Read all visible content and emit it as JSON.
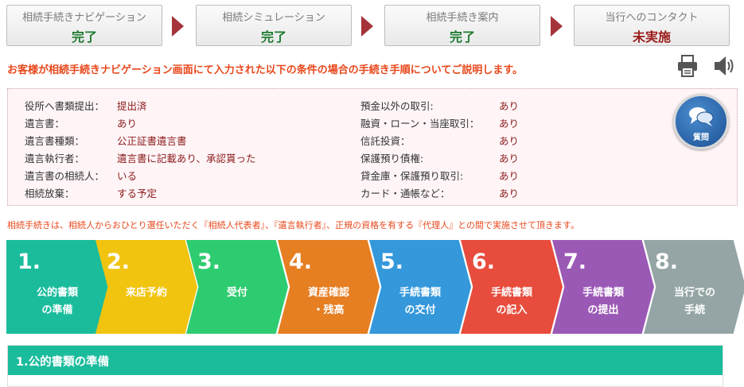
{
  "progress": [
    {
      "label": "相続手続きナビゲーション",
      "status": "完了"
    },
    {
      "label": "相続シミュレーション",
      "status": "完了"
    },
    {
      "label": "相続手続き案内",
      "status": "完了"
    },
    {
      "label": "当行へのコンタクト",
      "status": "未実施"
    }
  ],
  "intro": "お客様が相続手続きナビゲーション画面にて入力された以下の条件の場合の手続き手順についてご説明します。",
  "conditions": {
    "left": [
      {
        "key": "役所へ書類提出：",
        "value": "提出済"
      },
      {
        "key": "遺言書：",
        "value": "あり"
      },
      {
        "key": "遺言書種類：",
        "value": "公正証書遺言書"
      },
      {
        "key": "遺言執行者：",
        "value": "遺言書に記載あり、承認貰った"
      },
      {
        "key": "遺言書の相続人：",
        "value": "いる"
      },
      {
        "key": "相続放棄：",
        "value": "する予定"
      }
    ],
    "right": [
      {
        "key": "預金以外の取引:",
        "value": "あり"
      },
      {
        "key": "融資・ローン・当座取引：",
        "value": "あり"
      },
      {
        "key": "信託投資：",
        "value": "あり"
      },
      {
        "key": "保護預り債権:",
        "value": "あり"
      },
      {
        "key": "貸金庫・保護預り取引:",
        "value": "あり"
      },
      {
        "key": "カード・通帳など：",
        "value": "あり"
      }
    ]
  },
  "faq_label": "質問",
  "notice": "相続手続きは、相続人からおひとり選任いただく『相続人代表者』、『遺言執行者』、正規の資格を有する『代理人』との間で実施させて頂きます。",
  "steps": [
    {
      "num": "1.",
      "label": "公的書類\nの準備",
      "color": "#1abc9c"
    },
    {
      "num": "2.",
      "label": "来店予約",
      "color": "#f1c40f"
    },
    {
      "num": "3.",
      "label": "受付",
      "color": "#2ecc71"
    },
    {
      "num": "4.",
      "label": "資産確認\n・残高",
      "color": "#e67e22"
    },
    {
      "num": "5.",
      "label": "手続書類\nの交付",
      "color": "#3498db"
    },
    {
      "num": "6.",
      "label": "手続書類\nの記入",
      "color": "#e74c3c"
    },
    {
      "num": "7.",
      "label": "手続書類\nの提出",
      "color": "#9b59b6"
    },
    {
      "num": "8.",
      "label": "当行での\n手続",
      "color": "#95a5a6"
    }
  ],
  "section_title": "1.公的書類の準備",
  "icons": {
    "print": "printer-icon",
    "speaker": "speaker-icon",
    "faq": "chat-bubbles-icon"
  }
}
